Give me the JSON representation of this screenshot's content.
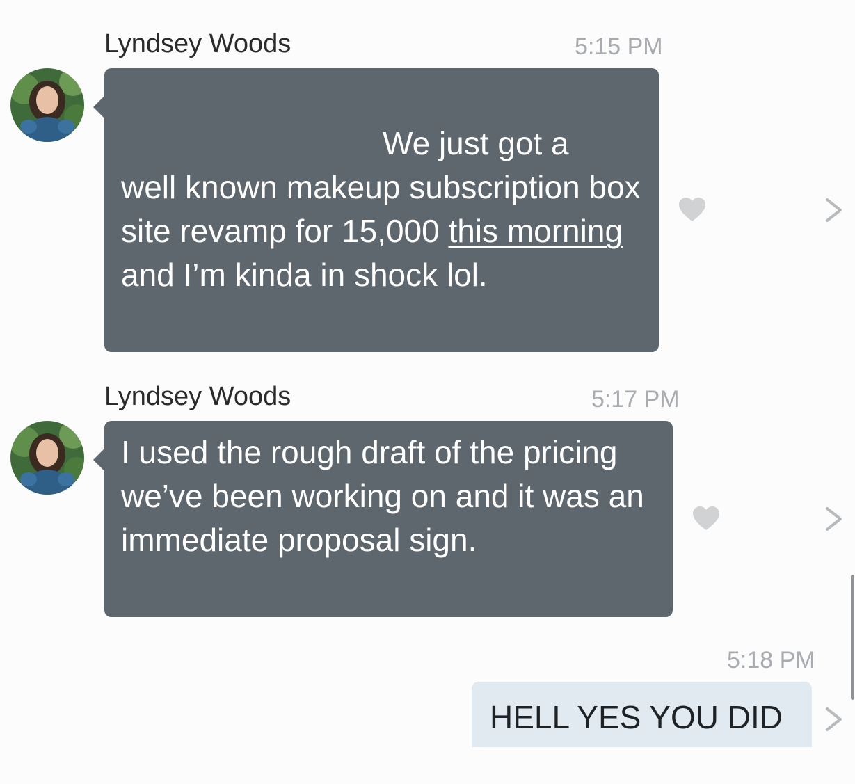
{
  "messages": [
    {
      "sender": "Lyndsey Woods",
      "time": "5:15 PM",
      "lead_in": "We just got a",
      "text_part1": "well known makeup subscription box site revamp for 15,000 ",
      "link_text": "this morning",
      "text_part2": " and I’m kinda in shock lol."
    },
    {
      "sender": "Lyndsey Woods",
      "time": "5:17 PM",
      "text": "I used the rough draft of the pricing we’ve been working on and it was an immediate proposal sign."
    },
    {
      "time": "5:18 PM",
      "text": "HELL YES YOU DID"
    }
  ],
  "icons": {
    "heart": "heart-icon",
    "chevron": "chevron-right-icon",
    "avatar": "avatar"
  },
  "colors": {
    "incoming_bubble": "#5e666e",
    "outgoing_bubble": "#e1eaf0",
    "timestamp": "#a8abb0",
    "heart": "#d0d2d4"
  }
}
